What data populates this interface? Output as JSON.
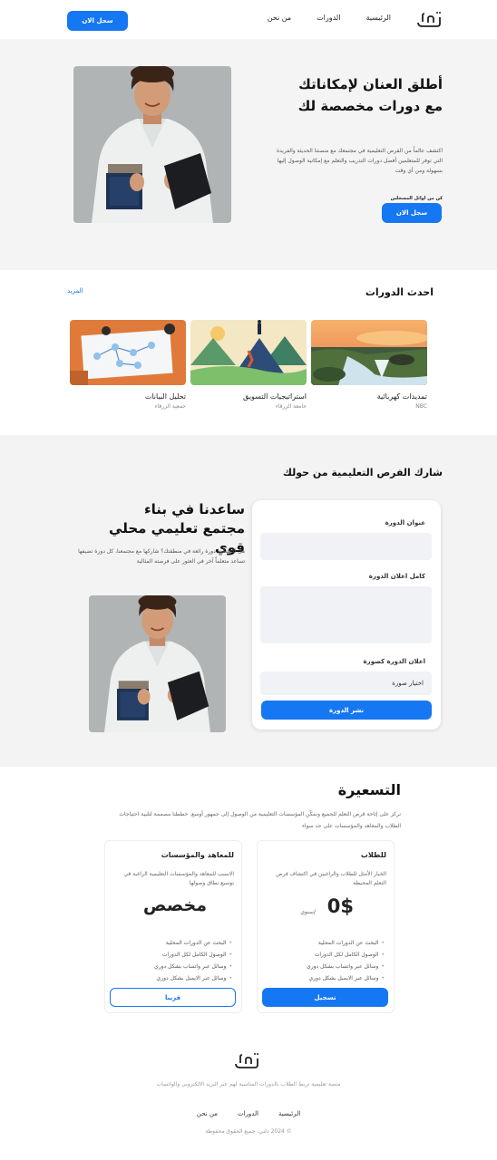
{
  "brand": {
    "logo_text": "دلني"
  },
  "header": {
    "nav": [
      "الرئيسية",
      "الدورات",
      "من نحن"
    ],
    "cta": "سجل الان"
  },
  "hero": {
    "title": "أطلق العنان لإمكاناتك مع دورات مخصصة لك",
    "description": "اكتشف عالماً من الفرص التعليمية في مجتمعك مع منصتنا الحديثة والفريدة التي توفر للمتعلمين أفضل دورات التدريب والتعلم مع إمكانية الوصول إليها بسهولة ومن أي وقت",
    "cta_note": "كن من اوائل المسجلين",
    "cta": "سجل الان"
  },
  "courses": {
    "title": "احدث الدورات",
    "more": "المزيد",
    "items": [
      {
        "name": "تمديدات كهربائية",
        "provider": "NBC",
        "image": "waterfall-landscape"
      },
      {
        "name": "استراتيجيات التسويق",
        "provider": "جامعة الزرقاء",
        "image": "mountain-summit-illustration"
      },
      {
        "name": "تحليل البيانات",
        "provider": "جمعية الزرقاء",
        "image": "meeting-flowchart"
      }
    ]
  },
  "share": {
    "title": "شارك الفرص التعليمية من حولك",
    "heading": "ساعدنا في بناء مجتمع تعليمي محلي قوي",
    "description": "هل اكتشفت دورة رائعة في منطقتك؟ شاركها مع مجتمعنا، كل دورة تضيفها تساعد متعلماً آخر في العثور على فرصته المثالية",
    "form": {
      "course_title_label": "عنوان الدورة",
      "course_ad_label": "كامل اعلان الدورة",
      "course_image_label": "اعلان الدورة كصورة",
      "choose_image": "اختيار صورة",
      "submit": "نشر الدورة"
    }
  },
  "pricing": {
    "title": "التسعيرة",
    "description": "نركز على إتاحة فرص التعلم للجميع ونمكّن المؤسسات التعليمية من الوصول إلى جمهور أوسع. خططنا مصممة لتلبية احتياجات الطلاب والمعاهد والمؤسسات على حد سواء",
    "plans": [
      {
        "name": "للطلاب",
        "description": "الخيار الأمثل للطلاب والراغبين في اكتشاف فرص التعلم المحيطة",
        "price": "0$",
        "period": "/سنوي",
        "features": [
          "البحث عن الدورات المحلية",
          "الوصول الكامل لكل الدورات",
          "وسائل عبر واتساب بشكل دوري",
          "وسائل عبر الايميل بشكل دوري"
        ],
        "button": "تسجيل"
      },
      {
        "name": "للمعاهد والمؤسسات",
        "description": "الانسب للمعاهد والمؤسسات التعليمية الراغبة في توسيع نطاق وصولها",
        "price": "مخصص",
        "period": "",
        "features": [
          "البحث عن الدورات المحلية",
          "الوصول الكامل لكل الدورات",
          "وسائل عبر واتساب بشكل دوري",
          "وسائل عبر الايميل بشكل دوري"
        ],
        "button": "قريبا"
      }
    ]
  },
  "footer": {
    "tagline": "منصة تعليمية تربط الطلاب بالدورات المناسبة لهم عبر البريد الالكتروني والواتساب",
    "nav": [
      "الرئيسية",
      "الدورات",
      "من نحن"
    ],
    "copyright": "© 2024 دلني. جميع الحقوق محفوظة"
  },
  "colors": {
    "primary": "#1677f2",
    "section_bg": "#f3f3f3"
  }
}
